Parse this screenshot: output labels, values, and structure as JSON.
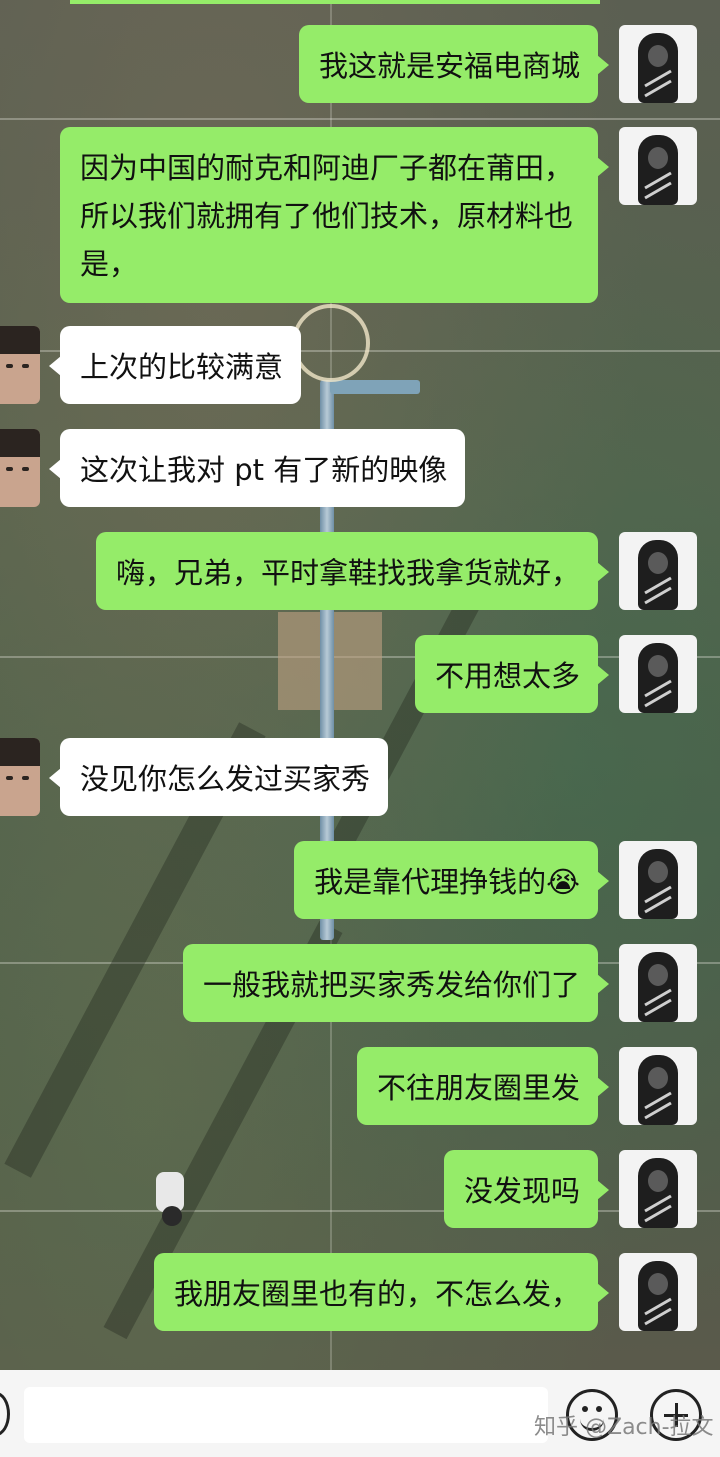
{
  "chat": {
    "messages": [
      {
        "side": "right",
        "text": "我这就是安福电商城"
      },
      {
        "side": "right",
        "text": "因为中国的耐克和阿迪厂子都在莆田，所以我们就拥有了他们技术，原材料也是，"
      },
      {
        "side": "left",
        "text": "上次的比较满意"
      },
      {
        "side": "left",
        "text": "这次让我对 pt 有了新的映像"
      },
      {
        "side": "right",
        "text": "嗨，兄弟，平时拿鞋找我拿货就好，"
      },
      {
        "side": "right",
        "text": "不用想太多"
      },
      {
        "side": "left",
        "text": "没见你怎么发过买家秀"
      },
      {
        "side": "right",
        "text": "我是靠代理挣钱的😭"
      },
      {
        "side": "right",
        "text": "一般我就把买家秀发给你们了"
      },
      {
        "side": "right",
        "text": "不往朋友圈里发"
      },
      {
        "side": "right",
        "text": "没发现吗"
      },
      {
        "side": "right",
        "text": "我朋友圈里也有的，不怎么发，"
      }
    ]
  },
  "input_bar": {
    "watermark": "知乎 @Zach-拉文",
    "icons": [
      "voice-icon",
      "emoji-icon",
      "plus-icon"
    ]
  },
  "colors": {
    "outgoing_bubble": "#95ec69",
    "incoming_bubble": "#ffffff"
  }
}
